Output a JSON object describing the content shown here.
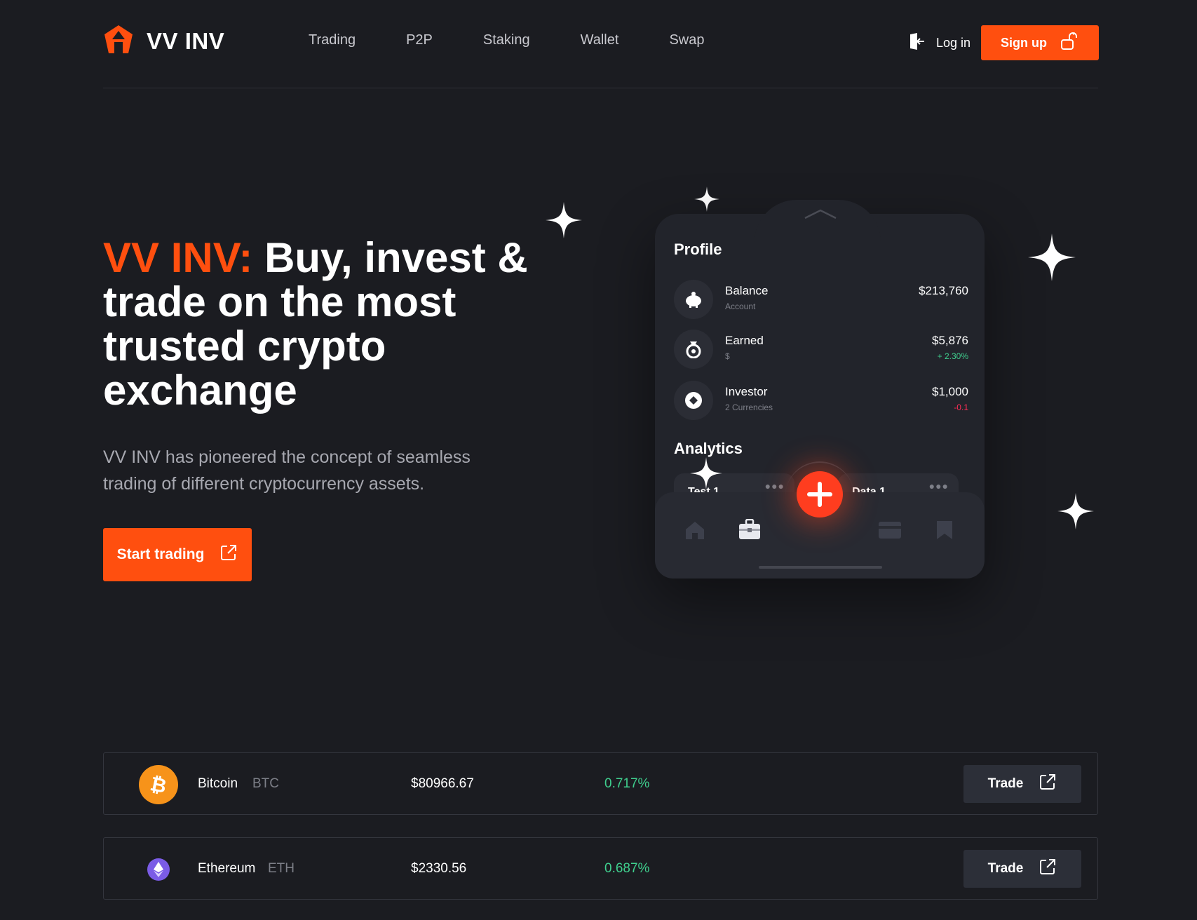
{
  "header": {
    "brand": "VV INV",
    "nav": [
      "Trading",
      "P2P",
      "Staking",
      "Wallet",
      "Swap"
    ],
    "login_label": "Log in",
    "signup_label": "Sign up"
  },
  "hero": {
    "title_accent": "VV INV:",
    "title_rest": "Buy, invest & trade on the most trusted crypto exchange",
    "description": "VV INV has pioneered the concept of seamless trading of different cryptocurrency assets.",
    "cta_label": "Start trading"
  },
  "phone": {
    "profile_title": "Profile",
    "rows": [
      {
        "label": "Balance",
        "sub": "Account",
        "value": "$213,760",
        "change": ""
      },
      {
        "label": "Earned",
        "sub": "$",
        "value": "$5,876",
        "change": "+ 2.30%"
      },
      {
        "label": "Investor",
        "sub": "2 Currencies",
        "value": "$1,000",
        "change": "-0.1"
      }
    ],
    "analytics_title": "Analytics",
    "mini_cards": [
      "Test 1",
      "Data 1"
    ],
    "colors": {
      "positive": "#3fcf8e",
      "negative": "#ff2d55",
      "accent": "#ff4f0f"
    }
  },
  "markets": [
    {
      "name": "Bitcoin",
      "symbol": "BTC",
      "price": "$80966.67",
      "change": "0.717%",
      "trade_label": "Trade",
      "icon": "bitcoin-icon"
    },
    {
      "name": "Ethereum",
      "symbol": "ETH",
      "price": "$2330.56",
      "change": "0.687%",
      "trade_label": "Trade",
      "icon": "ethereum-icon"
    }
  ]
}
